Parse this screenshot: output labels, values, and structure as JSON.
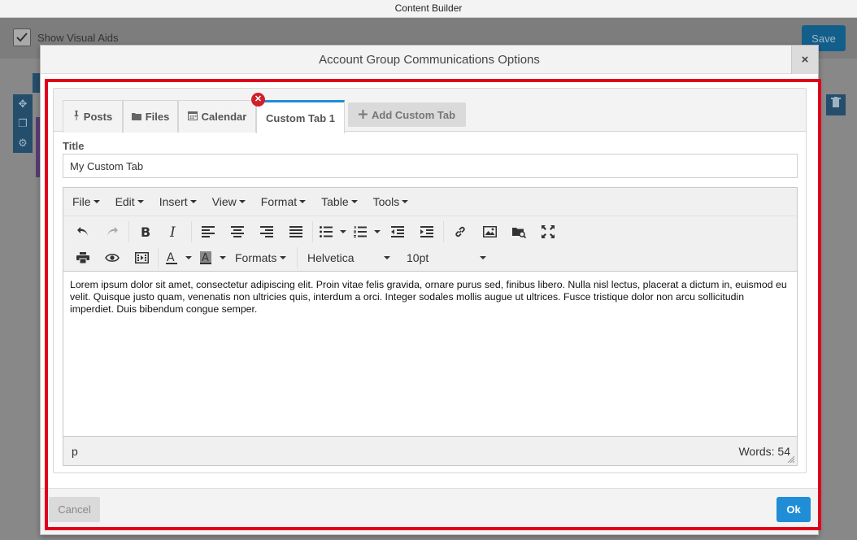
{
  "app": {
    "title": "Content Builder",
    "visual_aids_label": "Show Visual Aids",
    "save_label": "Save"
  },
  "modal": {
    "title": "Account Group Communications Options",
    "close_label": "×",
    "tabs": [
      {
        "label": "Posts",
        "icon": "pin-icon"
      },
      {
        "label": "Files",
        "icon": "folder-icon"
      },
      {
        "label": "Calendar",
        "icon": "calendar-icon"
      },
      {
        "label": "Custom Tab 1",
        "icon": "",
        "active": true
      }
    ],
    "add_tab_label": "Add Custom Tab",
    "title_field_label": "Title",
    "title_field_value": "My Custom Tab",
    "cancel_label": "Cancel",
    "ok_label": "Ok"
  },
  "editor": {
    "menus": [
      "File",
      "Edit",
      "Insert",
      "View",
      "Format",
      "Table",
      "Tools"
    ],
    "formats_label": "Formats",
    "font_family": "Helvetica",
    "font_size": "10pt",
    "content": "Lorem ipsum dolor sit amet, consectetur adipiscing elit. Proin vitae felis gravida, ornare purus sed, finibus libero. Nulla nisl lectus, placerat a dictum in, euismod eu velit. Quisque justo quam, venenatis non ultricies quis, interdum a orci. Integer sodales mollis augue ut ultrices. Fusce tristique dolor non arcu sollicitudin imperdiet. Duis bibendum congue semper.",
    "path": "p",
    "word_count": "Words: 54"
  },
  "colors": {
    "accent": "#1f8ed6",
    "highlight": "#e0001b",
    "remove_badge": "#d0202a"
  }
}
